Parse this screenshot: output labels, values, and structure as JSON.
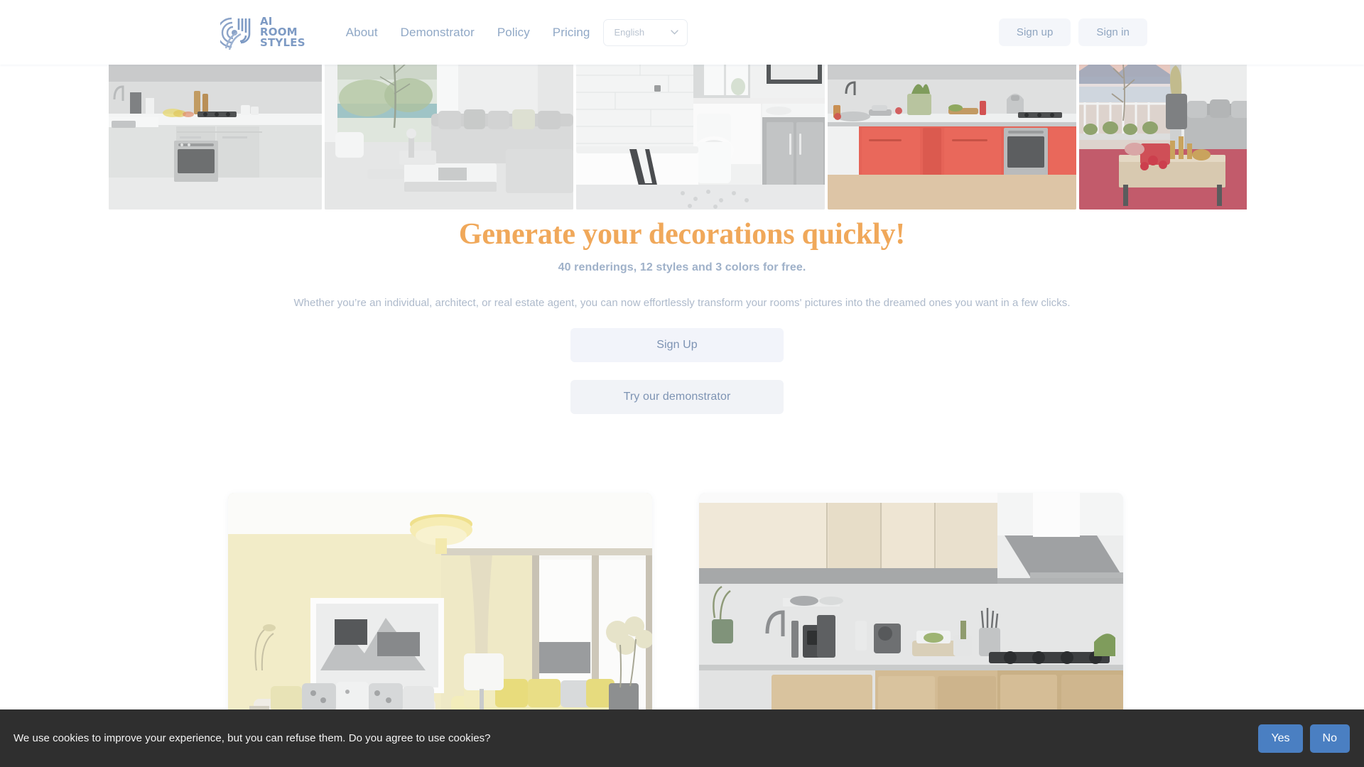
{
  "header": {
    "logo": {
      "icon": "airoomstyles-logo-icon",
      "line1": "AI",
      "line2": "ROOM",
      "line3": "STYLES",
      "color": "#7d9ac4"
    },
    "nav": [
      {
        "label": "About"
      },
      {
        "label": "Demonstrator"
      },
      {
        "label": "Policy"
      },
      {
        "label": "Pricing"
      }
    ],
    "language": {
      "value": "English",
      "icon": "chevron-down-icon"
    },
    "auth": {
      "sign_up": "Sign up",
      "sign_in": "Sign in"
    }
  },
  "hero": {
    "images": [
      {
        "alt": "white-modern-kitchen"
      },
      {
        "alt": "bright-living-room-with-garden-view"
      },
      {
        "alt": "white-tiled-bathroom"
      },
      {
        "alt": "red-cabinet-kitchen"
      },
      {
        "alt": "balcony-living-room-with-red-rug"
      }
    ],
    "title": "Generate your decorations quickly!",
    "title_color": "#f0a85a",
    "subtitle": "40 renderings, 12 styles and 3 colors for free.",
    "description": "Whether you’re an individual, architect, or real estate agent, you can now effortlessly transform your rooms' pictures into the dreamed ones you want in a few clicks.",
    "primary_cta": "Sign Up",
    "secondary_cta": "Try our demonstrator"
  },
  "showcase": {
    "cards": [
      {
        "alt": "yellow-living-room-rendering"
      },
      {
        "alt": "wood-and-grey-kitchen-rendering"
      }
    ]
  },
  "cookie_banner": {
    "message": "We use cookies to improve your experience, but you can refuse them. Do you agree to use cookies?",
    "accept": "Yes",
    "decline": "No",
    "button_color": "#4a7fc2",
    "background": "#2f2f2f"
  }
}
